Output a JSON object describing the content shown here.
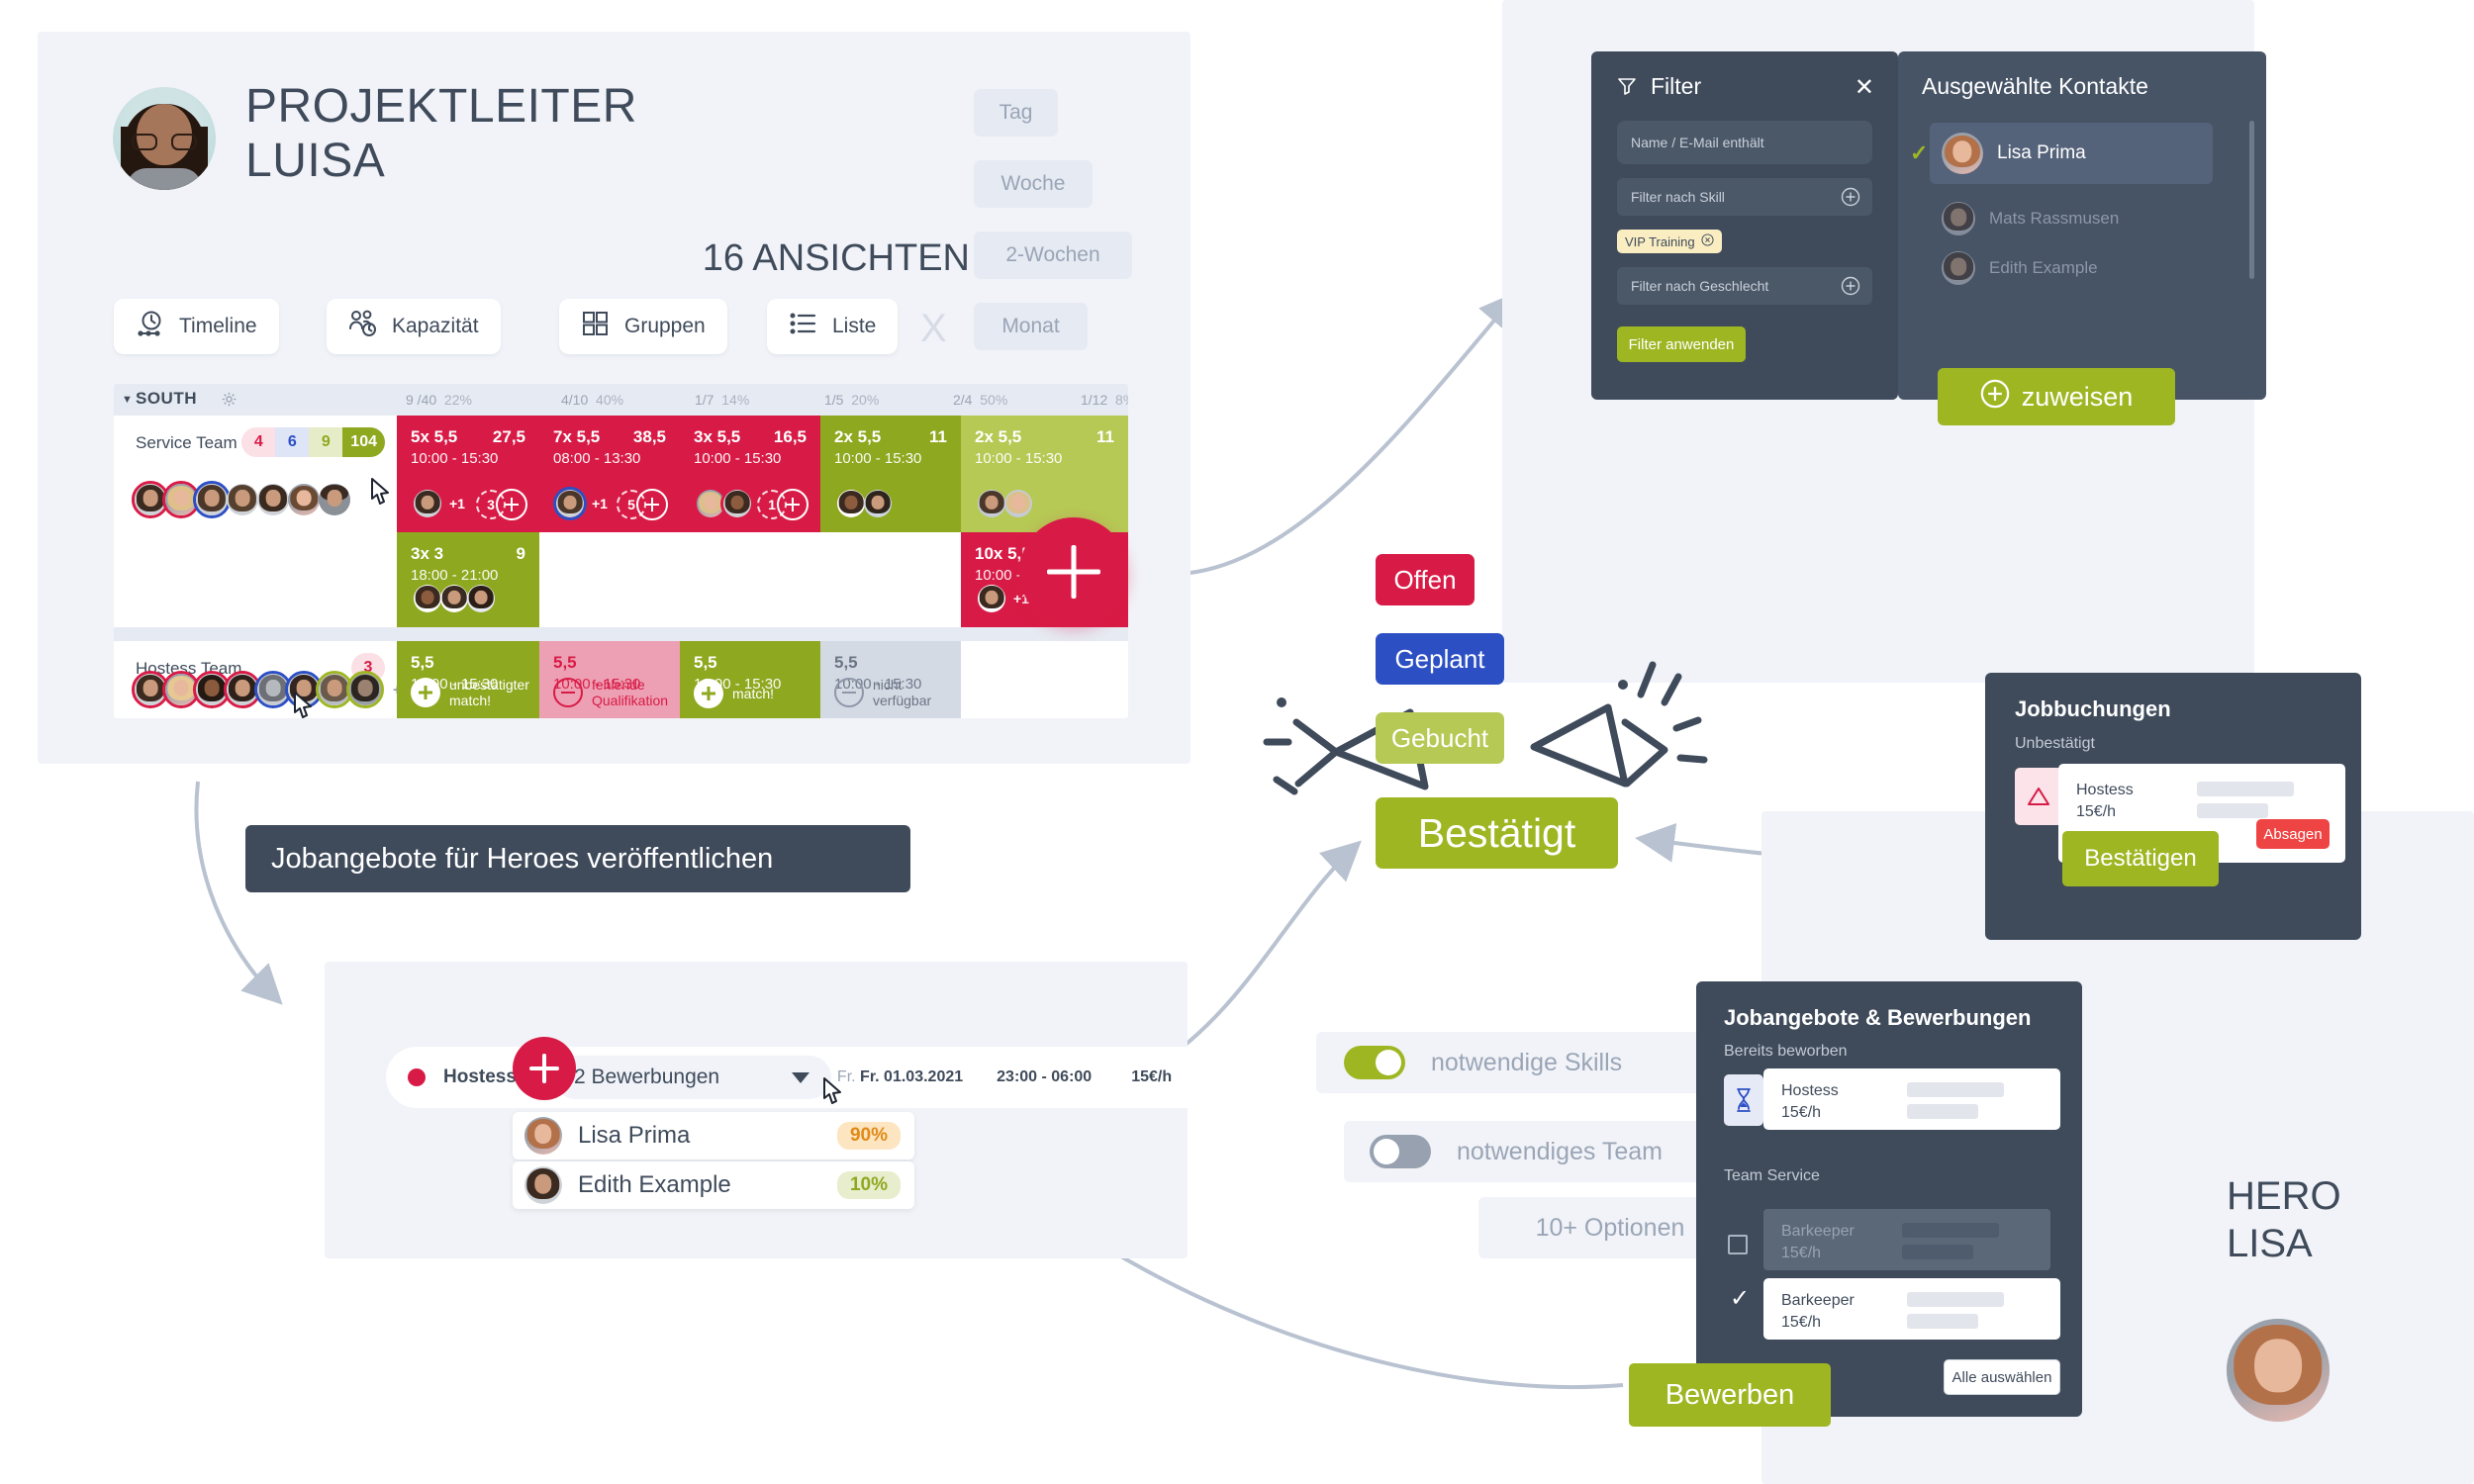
{
  "header": {
    "title_line1": "PROJEKTLEITER",
    "title_line2": "LUISA",
    "views_count": "16 ANSICHTEN",
    "close_label": "X",
    "view_buttons": [
      {
        "label": "Timeline",
        "icon": "clock-timeline-icon"
      },
      {
        "label": "Kapazität",
        "icon": "people-clock-icon"
      },
      {
        "label": "Gruppen",
        "icon": "grid-squares-icon"
      },
      {
        "label": "Liste",
        "icon": "list-icon"
      }
    ],
    "range_buttons": [
      {
        "label": "Tag"
      },
      {
        "label": "Woche"
      },
      {
        "label": "2-Wochen"
      },
      {
        "label": "Monat"
      }
    ]
  },
  "grid": {
    "group_label": "SOUTH",
    "group_stat_count": "9 /40",
    "group_stat_pct": "22%",
    "column_stats": [
      {
        "count": "4/10",
        "pct": "40%"
      },
      {
        "count": "1/7",
        "pct": "14%"
      },
      {
        "count": "1/5",
        "pct": "20%"
      },
      {
        "count": "2/4",
        "pct": "50%"
      },
      {
        "count": "1/12",
        "pct": "8%"
      }
    ],
    "rows": [
      {
        "team": "Service Team",
        "chips": [
          "4",
          "6",
          "9",
          "104"
        ],
        "plus_more": "",
        "cards": [
          {
            "qty": "5x 5,5",
            "total": "27,5",
            "time": "10:00 - 15:30",
            "extra": "+1",
            "open": "3",
            "style": "red"
          },
          {
            "qty": "7x 5,5",
            "total": "38,5",
            "time": "08:00 - 13:30",
            "extra": "+1",
            "open": "5",
            "style": "red"
          },
          {
            "qty": "3x 5,5",
            "total": "16,5",
            "time": "10:00 - 15:30",
            "extra": "",
            "open": "1",
            "style": "red"
          },
          {
            "qty": "2x 5,5",
            "total": "11",
            "time": "10:00 - 15:30",
            "extra": "",
            "open": "",
            "style": "olive"
          },
          {
            "qty": "2x 5,5",
            "total": "11",
            "time": "10:00 - 15:30",
            "extra": "",
            "open": "",
            "style": "olive2"
          }
        ]
      },
      {
        "team": "",
        "chips": [],
        "cards": [
          {
            "qty": "3x 3",
            "total": "9",
            "time": "18:00 - 21:00",
            "extra": "",
            "open": "",
            "style": "olive"
          },
          {
            "qty": "",
            "total": "",
            "time": "",
            "extra": "",
            "open": "",
            "style": "white"
          },
          {
            "qty": "",
            "total": "",
            "time": "",
            "extra": "",
            "open": "",
            "style": "white"
          },
          {
            "qty": "",
            "total": "",
            "time": "",
            "extra": "",
            "open": "",
            "style": "white"
          },
          {
            "qty": "10x 5,5",
            "total": "",
            "time": "10:00 - 15:30",
            "extra": "+1",
            "open": "",
            "style": "red"
          }
        ]
      },
      {
        "team": "Hostess Team",
        "chips": [
          "3"
        ],
        "plus_more": "+3",
        "cards": [
          {
            "qty": "5,5",
            "total": "",
            "time": "10:00 - 15:30",
            "status": "unbestätigter match!",
            "status_icon": "plus-filled-icon",
            "style": "olive"
          },
          {
            "qty": "5,5",
            "total": "",
            "time": "10:00 - 15:30",
            "status": "fehlende Qualifikation",
            "status_icon": "minus-circle-icon",
            "style": "pink"
          },
          {
            "qty": "5,5",
            "total": "",
            "time": "10:00 - 15:30",
            "status": "match!",
            "status_icon": "plus-filled-icon",
            "style": "olive"
          },
          {
            "qty": "5,5",
            "total": "",
            "time": "10:00 - 15:30",
            "status": "nicht verfügbar",
            "status_icon": "minus-circle-icon",
            "style": "grey"
          },
          {
            "qty": "",
            "total": "",
            "time": "",
            "status": "",
            "style": "white"
          }
        ]
      }
    ]
  },
  "filter": {
    "title": "Filter",
    "close_label": "✕",
    "name_placeholder": "Name / E-Mail enthält",
    "skill_placeholder": "Filter nach Skill",
    "skill_tag": "VIP Training",
    "gender_placeholder": "Filter nach Geschlecht",
    "apply_label": "Filter anwenden"
  },
  "contacts": {
    "title": "Ausgewählte Kontakte",
    "items": [
      {
        "name": "Lisa Prima",
        "selected": true
      },
      {
        "name": "Mats Rassmusen",
        "selected": false
      },
      {
        "name": "Edith Example",
        "selected": false
      }
    ],
    "assign_label": "zuweisen"
  },
  "statuses": [
    {
      "label": "Offen",
      "color": "#d81b46"
    },
    {
      "label": "Geplant",
      "color": "#2c4fc4"
    },
    {
      "label": "Gebucht",
      "color": "#b6c955"
    },
    {
      "label": "Bestätigt",
      "color": "#9fb623"
    }
  ],
  "jobbuchungen": {
    "title": "Jobbuchungen",
    "subtitle": "Unbestätigt",
    "booking": {
      "role": "Hostess",
      "rate": "15€/h"
    },
    "confirm_label": "Bestätigen",
    "cancel_label": "Absagen"
  },
  "publish_banner": "Jobangebote für Heroes veröffentlichen",
  "applications": {
    "role": "Hostess",
    "select_value": "2 Bewerbungen",
    "date": "Fr. 01.03.2021",
    "time": "23:00 - 06:00",
    "rate": "15€/h",
    "items": [
      {
        "name": "Lisa Prima",
        "match": "90%",
        "style": "orange"
      },
      {
        "name": "Edith Example",
        "match": "10%",
        "style": "green"
      }
    ]
  },
  "toggles": [
    {
      "label": "notwendige Skills",
      "state": "on"
    },
    {
      "label": "notwendiges Team",
      "state": "off"
    }
  ],
  "options_label": "10+ Optionen",
  "jobangebote": {
    "title": "Jobangebote & Bewerbungen",
    "section_applied": "Bereits beworben",
    "applied_item": {
      "role": "Hostess",
      "rate": "15€/h"
    },
    "section_team": "Team Service",
    "team_items": [
      {
        "role": "Barkeeper",
        "rate": "15€/h",
        "checked": false
      },
      {
        "role": "Barkeeper",
        "rate": "15€/h",
        "checked": true
      }
    ],
    "select_all_label": "Alle auswählen",
    "apply_label": "Bewerben"
  },
  "hero": {
    "title_line1": "HERO",
    "title_line2": "LISA"
  }
}
